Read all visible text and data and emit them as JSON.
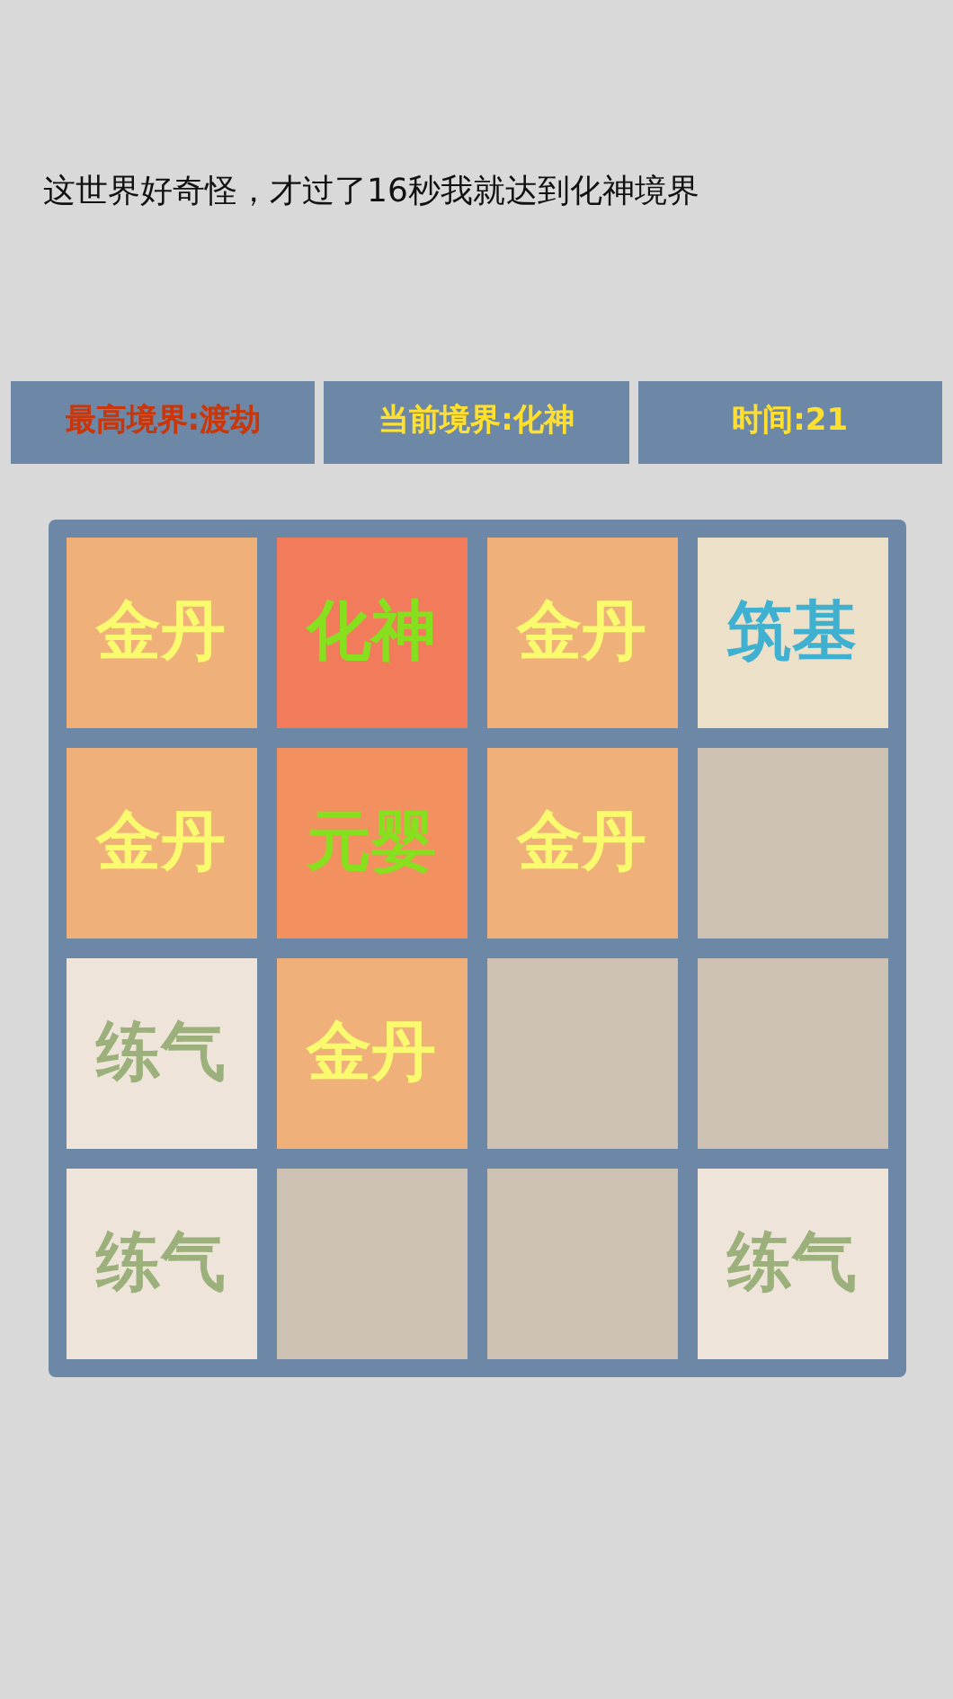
{
  "message": "这世界好奇怪，才过了16秒我就达到化神境界",
  "status_bar": [
    {
      "kind": "best",
      "text": "最高境界:渡劫"
    },
    {
      "kind": "current",
      "text": "当前境界:化神"
    },
    {
      "kind": "time",
      "text": "时间:21"
    }
  ],
  "board": [
    {
      "kind": "jindan",
      "label": "金丹"
    },
    {
      "kind": "huashen",
      "label": "化神"
    },
    {
      "kind": "jindan",
      "label": "金丹"
    },
    {
      "kind": "zhuji",
      "label": "筑基"
    },
    {
      "kind": "jindan",
      "label": "金丹"
    },
    {
      "kind": "yuanying",
      "label": "元婴"
    },
    {
      "kind": "jindan",
      "label": "金丹"
    },
    {
      "kind": "empty"
    },
    {
      "kind": "lianqi",
      "label": "练气"
    },
    {
      "kind": "jindan",
      "label": "金丹"
    },
    {
      "kind": "empty"
    },
    {
      "kind": "empty"
    },
    {
      "kind": "lianqi",
      "label": "练气"
    },
    {
      "kind": "empty"
    },
    {
      "kind": "empty"
    },
    {
      "kind": "lianqi",
      "label": "练气"
    }
  ]
}
